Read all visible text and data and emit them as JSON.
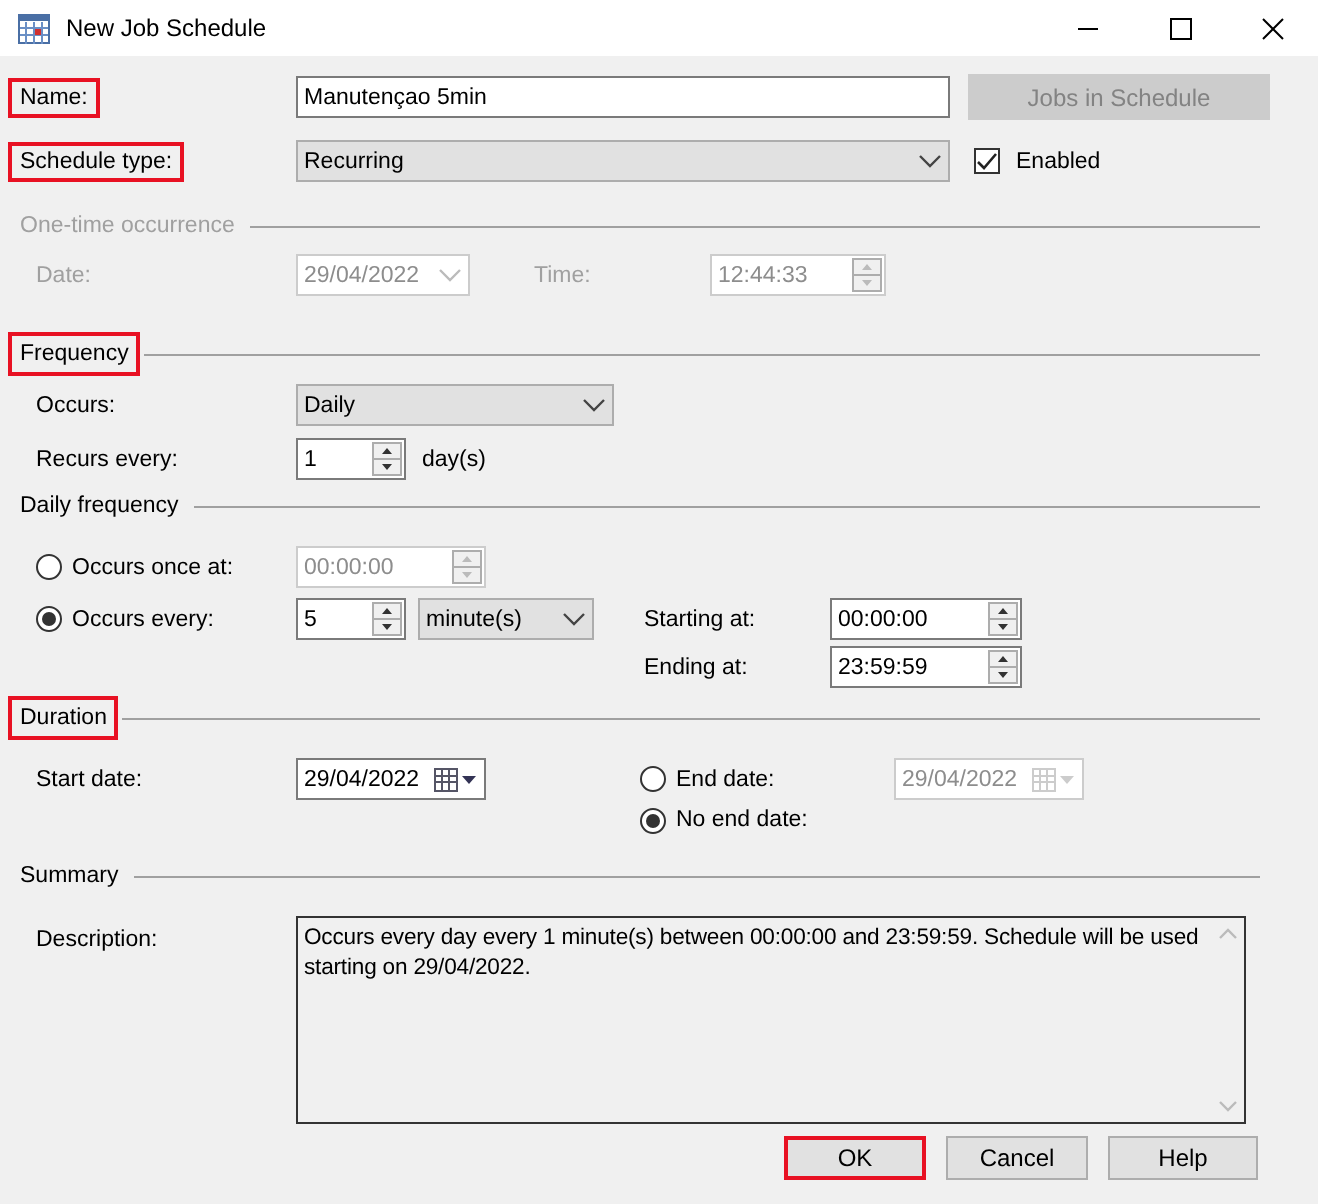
{
  "window": {
    "title": "New Job Schedule"
  },
  "name": {
    "label": "Name:",
    "highlighted": true,
    "value": "Manutençao 5min"
  },
  "jobs_button": {
    "label": "Jobs in Schedule",
    "disabled": true
  },
  "schedule_type": {
    "label": "Schedule type:",
    "highlighted": true,
    "value": "Recurring"
  },
  "enabled": {
    "label": "Enabled",
    "checked": true
  },
  "one_time": {
    "title": "One-time occurrence",
    "disabled": true,
    "date_label": "Date:",
    "date": "29/04/2022",
    "time_label": "Time:",
    "time": "12:44:33"
  },
  "frequency": {
    "title": "Frequency",
    "highlighted": true,
    "occurs_label": "Occurs:",
    "occurs": "Daily",
    "recurs_label": "Recurs every:",
    "recurs": "1",
    "recurs_unit": "day(s)"
  },
  "daily_frequency": {
    "title": "Daily frequency",
    "options": [
      {
        "label": "Occurs once at:",
        "selected": false,
        "time": "00:00:00"
      },
      {
        "label": "Occurs every:",
        "selected": true,
        "value": "5",
        "unit": "minute(s)"
      }
    ],
    "starting_label": "Starting at:",
    "starting": "00:00:00",
    "ending_label": "Ending at:",
    "ending": "23:59:59"
  },
  "duration": {
    "title": "Duration",
    "highlighted": true,
    "start_label": "Start date:",
    "start_date": "29/04/2022",
    "end_options": [
      {
        "label": "End date:",
        "selected": false,
        "date": "29/04/2022"
      },
      {
        "label": "No end date:",
        "selected": true
      }
    ]
  },
  "summary": {
    "title": "Summary",
    "description_label": "Description:",
    "description": "Occurs every day every 1 minute(s) between 00:00:00 and 23:59:59. Schedule will be used starting on 29/04/2022."
  },
  "buttons": [
    {
      "label": "OK",
      "highlighted": true
    },
    {
      "label": "Cancel",
      "highlighted": false
    },
    {
      "label": "Help",
      "highlighted": false
    }
  ]
}
